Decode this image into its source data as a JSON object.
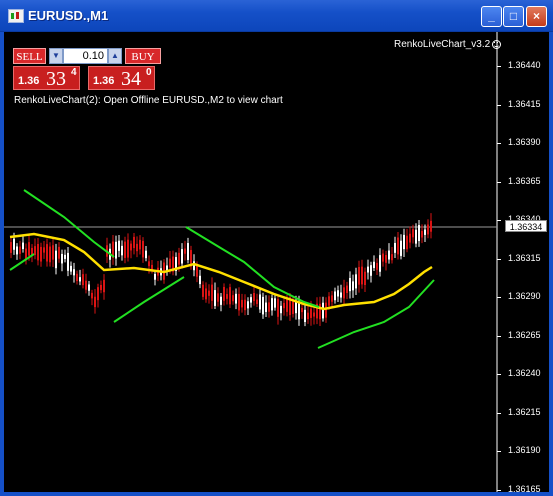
{
  "window": {
    "title": "EURUSD.,M1",
    "buttons": {
      "minimize": "_",
      "maximize": "□",
      "close": "×"
    }
  },
  "trade_panel": {
    "sell_label": "SELL",
    "buy_label": "BUY",
    "lot_value": "0.10",
    "bid": {
      "prefix": "1.36",
      "big": "33",
      "sup": "4"
    },
    "ask": {
      "prefix": "1.36",
      "big": "34",
      "sup": "0"
    }
  },
  "indicator_label": "RenkoLiveChart_v3.2",
  "info_text": "RenkoLiveChart(2): Open Offline EURUSD.,M2 to view chart",
  "price_axis": [
    "1.36440",
    "1.36415",
    "1.36390",
    "1.36365",
    "1.36340",
    "1.36315",
    "1.36290",
    "1.36265",
    "1.36240",
    "1.36215",
    "1.36190",
    "1.36165"
  ],
  "current_price": "1.36334",
  "colors": {
    "background": "#000000",
    "bull_candle": "#ffffff",
    "bear_candle": "#dc1414",
    "ma_yellow": "#ffe000",
    "band_green": "#22e022",
    "price_line": "#9a9a9a",
    "titlebar": "#1550c8"
  }
}
